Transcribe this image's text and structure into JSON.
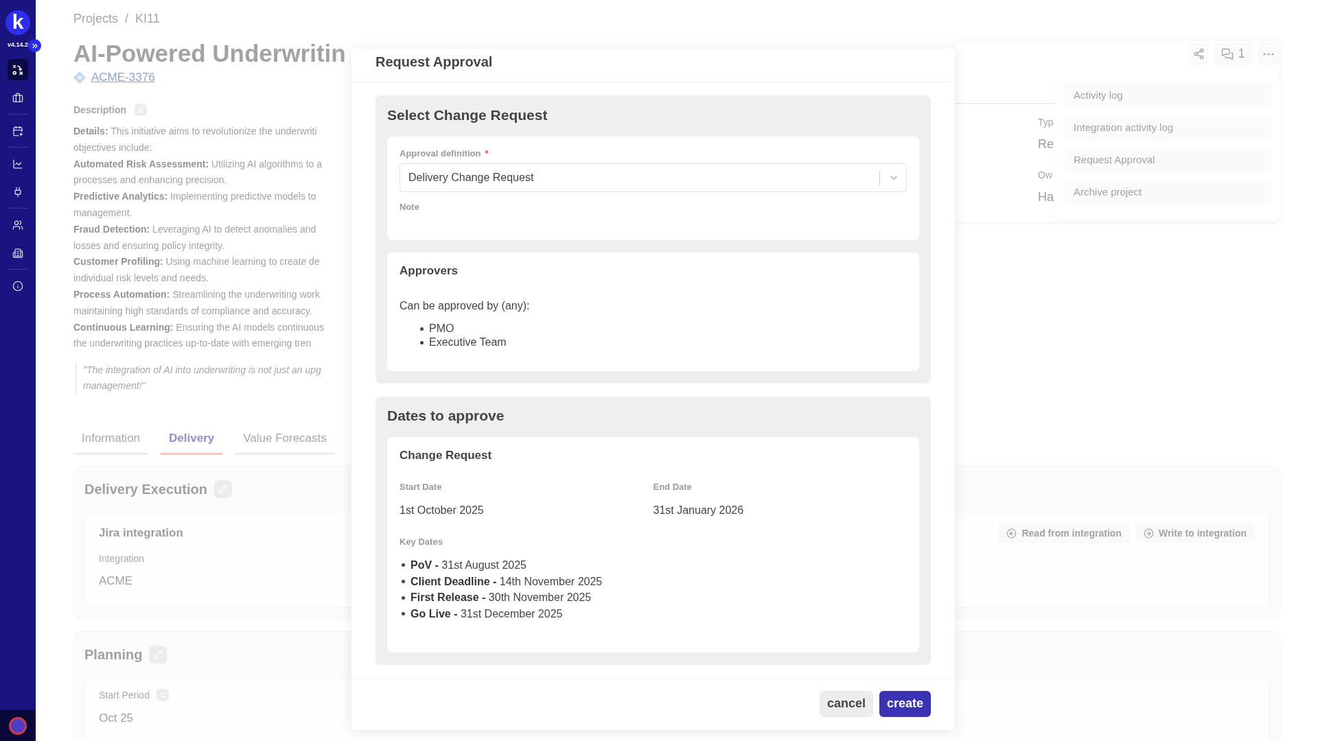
{
  "sidebar": {
    "logo": "k",
    "version": "v4.14.2",
    "groups": [
      {
        "items": [
          {
            "selected": true
          },
          {
            "selected": false
          }
        ]
      },
      {
        "items": [
          {
            "selected": false
          }
        ]
      },
      {
        "items": [
          {
            "selected": false
          },
          {
            "selected": false
          }
        ]
      },
      {
        "items": [
          {
            "selected": false
          },
          {
            "selected": false
          }
        ]
      },
      {
        "items": [
          {
            "selected": false
          }
        ]
      }
    ]
  },
  "breadcrumb": {
    "items": [
      "Projects",
      "KI11"
    ],
    "separator": "/"
  },
  "project": {
    "title": "AI-Powered Underwritin",
    "key": "ACME-3376"
  },
  "description": {
    "label": "Description",
    "lines": [
      "**Details:** This initiative aims to revolutionize the underwriti",
      "objectives include:",
      "**Automated Risk Assessment:** Utilizing AI algorithms to a",
      "processes and enhancing precision.",
      "**Predictive Analytics:** Implementing predictive models to",
      "management.",
      "**Fraud Detection:** Leveraging AI to detect anomalies and",
      "losses and ensuring policy integrity.",
      "**Customer Profiling:** Using machine learning to create de",
      "individual risk levels and needs.",
      "**Process Automation:** Streamlining the underwriting work",
      "maintaining high standards of compliance and accuracy.",
      "**Continuous Learning:** Ensuring the AI models continuous",
      "the underwriting practices up-to-date with emerging tren"
    ],
    "quote": [
      "\"The integration of AI into underwriting is not just an upg",
      "management!\""
    ]
  },
  "header_actions": {
    "comment_count": "1"
  },
  "details_panel": {
    "fields": [
      {
        "label": "Typ",
        "value": "Re"
      },
      {
        "label": "Ow",
        "value": "Ha"
      }
    ]
  },
  "actions_menu": {
    "items": [
      "Activity log",
      "Integration activity log",
      "Request Approval",
      "Archive project"
    ]
  },
  "tabs": [
    {
      "label": "Information",
      "selected": false
    },
    {
      "label": "Delivery",
      "selected": true
    },
    {
      "label": "Value Forecasts",
      "selected": false
    }
  ],
  "panels": [
    {
      "kind": "integration",
      "title": "Delivery Execution",
      "card_title": "Jira integration",
      "field": {
        "label": "Integration",
        "value": "ACME"
      },
      "actions": [
        "Read from integration",
        "Write to integration"
      ]
    },
    {
      "kind": "period",
      "title": "Planning",
      "field": {
        "label": "Start Period",
        "value": "Oct 25"
      }
    }
  ],
  "modal": {
    "title": "Request Approval",
    "select_section": {
      "title": "Select Change Request",
      "approval_definition": {
        "label": "Approval definition",
        "required_mark": "*",
        "value": "Delivery Change Request"
      },
      "note": {
        "label": "Note"
      },
      "approvers": {
        "title": "Approvers",
        "text": "Can be approved by (any):",
        "list": [
          "PMO",
          "Executive Team"
        ]
      }
    },
    "dates_section": {
      "title": "Dates to approve",
      "card_title": "Change Request",
      "start": {
        "label": "Start Date",
        "value": "1st October 2025"
      },
      "end": {
        "label": "End Date",
        "value": "31st January 2026"
      },
      "key_dates": {
        "label": "Key Dates",
        "items": [
          "**PoV -** 31st August 2025",
          "**Client Deadline -** 14th November 2025",
          "**First Release -** 30th November 2025",
          "**Go Live -** 31st December 2025"
        ]
      }
    },
    "buttons": [
      {
        "label": "cancel",
        "kind": "secondary"
      },
      {
        "label": "create",
        "kind": "primary"
      }
    ]
  }
}
